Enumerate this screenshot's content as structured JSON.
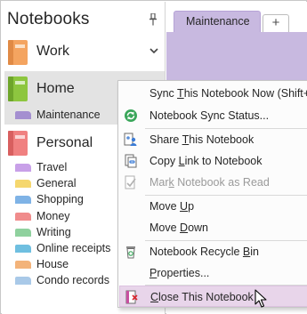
{
  "left_pane": {
    "title": "Notebooks",
    "notebooks": {
      "work": {
        "label": "Work",
        "color": "#f4a460"
      },
      "home": {
        "label": "Home",
        "color": "#8dc63f"
      },
      "personal": {
        "label": "Personal",
        "color": "#f08080"
      }
    },
    "home_sections": [
      {
        "label": "Maintenance",
        "color": "#a48fd0"
      }
    ],
    "personal_sections": [
      {
        "label": "Travel",
        "color": "#c8a0e8"
      },
      {
        "label": "General",
        "color": "#f5d76e"
      },
      {
        "label": "Shopping",
        "color": "#7fb3e6"
      },
      {
        "label": "Money",
        "color": "#f08c8c"
      },
      {
        "label": "Writing",
        "color": "#8fd19e"
      },
      {
        "label": "Online receipts",
        "color": "#6fbfe0"
      },
      {
        "label": "House",
        "color": "#f3b37a"
      },
      {
        "label": "Condo records",
        "color": "#a9c9e8"
      }
    ]
  },
  "tabs": {
    "active_label": "Maintenance",
    "add_label": "+",
    "active_color": "#c8b9e0"
  },
  "context_menu": {
    "items": [
      {
        "pre": "Sync ",
        "u": "T",
        "post": "his Notebook Now  (Shift+",
        "icon": "none"
      },
      {
        "pre": "Notebook Sync Status...",
        "u": "",
        "post": "",
        "icon": "sync-status-icon"
      },
      {
        "pre": "Share ",
        "u": "T",
        "post": "his Notebook",
        "icon": "share-icon"
      },
      {
        "pre": "Copy ",
        "u": "L",
        "post": "ink to Notebook",
        "icon": "copy-link-icon"
      },
      {
        "pre": "Mar",
        "u": "k",
        "post": " Notebook as Read",
        "icon": "mark-read-icon"
      },
      {
        "pre": "Move ",
        "u": "U",
        "post": "p",
        "icon": "none"
      },
      {
        "pre": "Move ",
        "u": "D",
        "post": "own",
        "icon": "none"
      },
      {
        "pre": "Notebook Recycle ",
        "u": "B",
        "post": "in",
        "icon": "recycle-bin-icon"
      },
      {
        "pre": "",
        "u": "P",
        "post": "roperties...",
        "icon": "none"
      },
      {
        "pre": "",
        "u": "C",
        "post": "lose This Notebook",
        "icon": "close-notebook-icon"
      }
    ]
  }
}
